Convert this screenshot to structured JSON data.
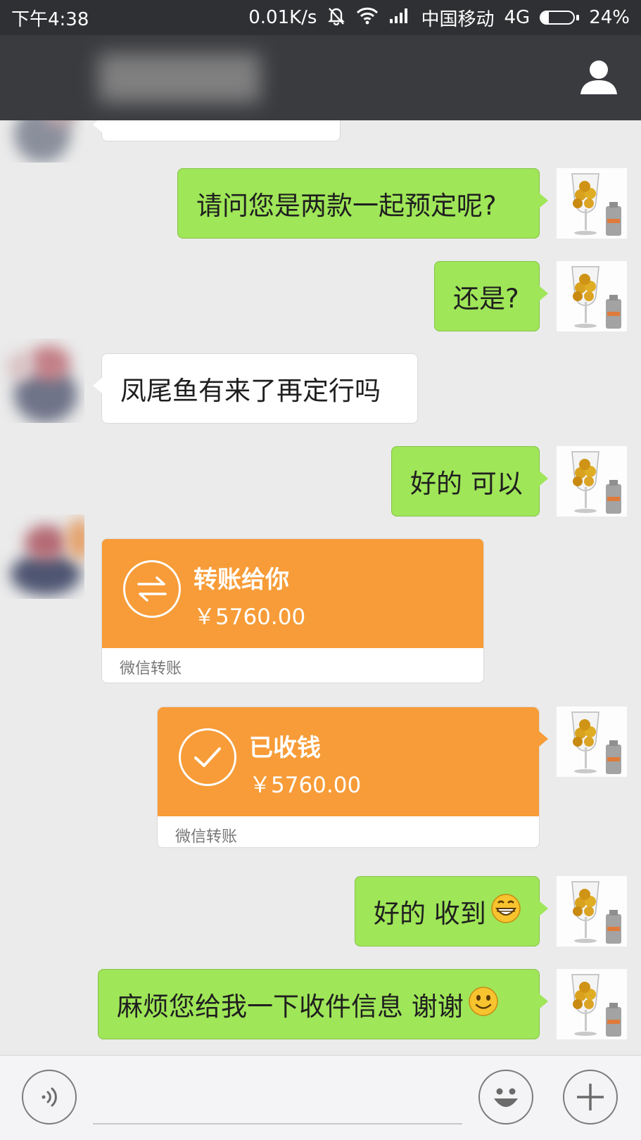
{
  "status_bar": {
    "time": "下午4:38",
    "net_speed": "0.01K/s",
    "carrier": "中国移动",
    "network": "4G",
    "battery_percent": "24%",
    "battery_level": 0.24,
    "icons": [
      "bell-muted-icon",
      "wifi-icon",
      "signal-icon",
      "battery-icon"
    ]
  },
  "header": {
    "profile_icon": "person-icon"
  },
  "messages": [
    {
      "side": "out",
      "text": "请问您是两款一起预定呢?"
    },
    {
      "side": "out",
      "text": "还是?"
    },
    {
      "side": "in",
      "text": "凤尾鱼有来了再定行吗"
    },
    {
      "side": "out",
      "text": "好的  可以"
    },
    {
      "side": "in",
      "type": "transfer",
      "title": "转账给你",
      "amount": "￥5760.00",
      "footer": "微信转账",
      "icon": "transfer-arrows-icon"
    },
    {
      "side": "out",
      "type": "transfer",
      "title": "已收钱",
      "amount": "￥5760.00",
      "footer": "微信转账",
      "icon": "checkmark-icon"
    },
    {
      "side": "out",
      "text": "好的  收到",
      "emoji": "grin-emoji"
    },
    {
      "side": "out",
      "text": "麻烦您给我一下收件信息  谢谢",
      "emoji": "smile-emoji"
    }
  ],
  "input_bar": {
    "voice_icon": "voice-icon",
    "emoji_icon": "emoji-face-icon",
    "plus_icon": "plus-icon"
  },
  "colors": {
    "outgoing_bubble": "#9fe658",
    "incoming_bubble": "#ffffff",
    "transfer_orange": "#f79c38",
    "header": "#3a3b3f",
    "chat_background": "#ebebeb"
  }
}
